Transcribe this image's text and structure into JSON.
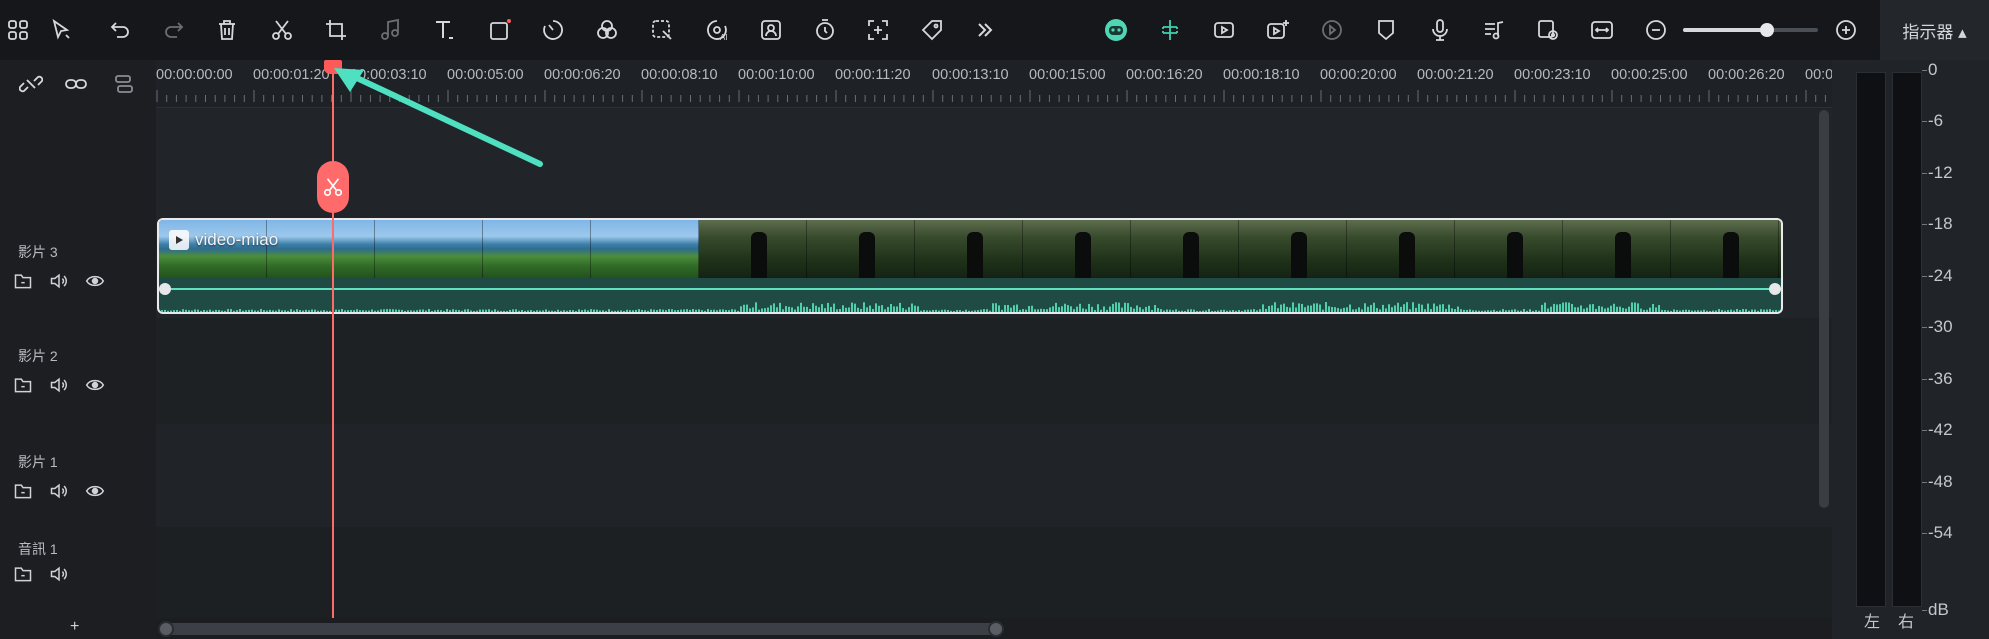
{
  "toolbar": {
    "left_icons": [
      "grid-icon",
      "select-arrow-icon",
      "undo-icon",
      "redo-icon",
      "delete-icon",
      "cut-icon",
      "crop-icon",
      "audio-note-icon",
      "text-icon",
      "shape-icon",
      "speed-icon",
      "color-icon",
      "mask-icon",
      "ai-icon",
      "portrait-icon",
      "timer-icon",
      "add-frame-icon",
      "tag-icon",
      "more-icon"
    ],
    "right_icons": [
      "ai-assistant-icon",
      "snap-icon",
      "render-preview-icon",
      "add-video-icon",
      "marker-disabled-icon",
      "shield-icon",
      "microphone-icon",
      "music-list-icon",
      "preview-toggle-icon",
      "fit-icon",
      "zoom-out-icon",
      "zoom-in-icon"
    ],
    "zoom_level": 0.62,
    "accent_colors": {
      "ai": "#4fd6b5",
      "snap": "#3fd0b0",
      "playhead": "#ff6b6b"
    }
  },
  "meter": {
    "title": "指示器 ▴",
    "scale": [
      "0",
      "-6",
      "-12",
      "-18",
      "-24",
      "-30",
      "-36",
      "-42",
      "-48",
      "-54",
      "dB"
    ],
    "left_label": "左",
    "right_label": "右"
  },
  "ruler": {
    "tools": [
      "unlink-icon",
      "link-icon",
      "layout-icon"
    ],
    "labels": [
      "00:00:00:00",
      "00:00:01:20",
      "00:00:03:10",
      "00:00:05:00",
      "00:00:06:20",
      "00:00:08:10",
      "00:00:10:00",
      "00:00:11:20",
      "00:00:13:10",
      "00:00:15:00",
      "00:00:16:20",
      "00:00:18:10",
      "00:00:20:00",
      "00:00:21:20",
      "00:00:23:10",
      "00:00:25:00",
      "00:00:26:20",
      "00:0"
    ]
  },
  "tracks": [
    {
      "name": "影片 3",
      "icons": [
        "folder-lock-icon",
        "speaker-icon",
        "eye-icon"
      ]
    },
    {
      "name": "影片 2",
      "icons": [
        "folder-lock-icon",
        "speaker-icon",
        "eye-icon"
      ]
    },
    {
      "name": "影片 1",
      "icons": [
        "folder-lock-icon",
        "speaker-icon",
        "eye-icon"
      ]
    },
    {
      "name": "音訊 1",
      "icons": [
        "folder-lock-icon",
        "speaker-icon"
      ]
    }
  ],
  "add_track_label": "+",
  "clip": {
    "title": "video-miao",
    "scenes": [
      "beach",
      "beach",
      "beach",
      "beach",
      "beach",
      "forest",
      "forest",
      "forest",
      "forest",
      "forest",
      "forest",
      "forest",
      "forest",
      "forest",
      "forest",
      "forest"
    ]
  },
  "playhead": {
    "timecode": "00:00:01:20"
  }
}
